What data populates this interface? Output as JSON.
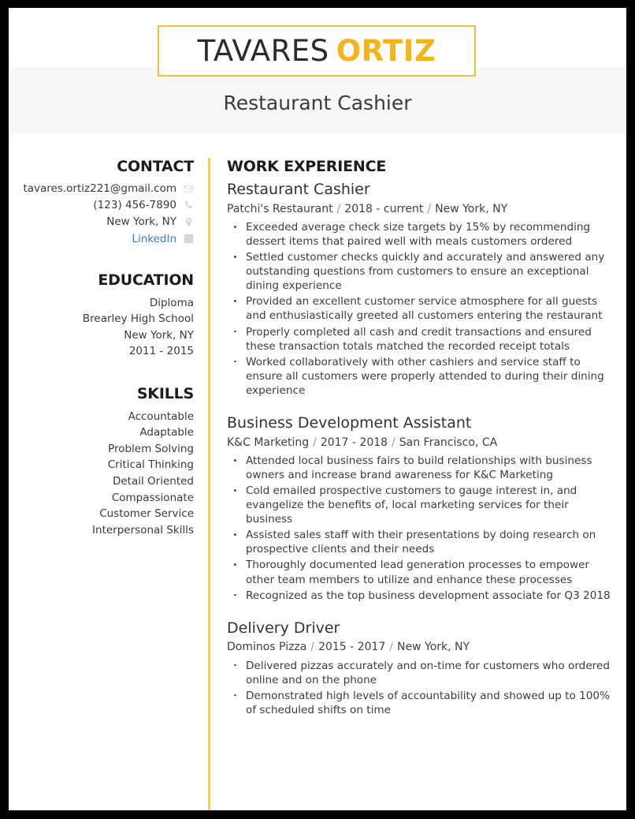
{
  "header": {
    "name_first": "TAVARES",
    "name_last": "ORTIZ",
    "job_title": "Restaurant Cashier"
  },
  "sidebar": {
    "contact": {
      "heading": "CONTACT",
      "items": [
        {
          "text": "tavares.ortiz221@gmail.com",
          "icon": "envelope-icon",
          "is_link": false
        },
        {
          "text": "(123) 456-7890",
          "icon": "phone-icon",
          "is_link": false
        },
        {
          "text": "New York, NY",
          "icon": "map-pin-icon",
          "is_link": false
        },
        {
          "text": "LinkedIn",
          "icon": "linkedin-icon",
          "is_link": true
        }
      ]
    },
    "education": {
      "heading": "EDUCATION",
      "lines": [
        "Diploma",
        "Brearley High School",
        "New York, NY",
        "2011 - 2015"
      ]
    },
    "skills": {
      "heading": "SKILLS",
      "items": [
        "Accountable",
        "Adaptable",
        "Problem Solving",
        "Critical Thinking",
        "Detail Oriented",
        "Compassionate",
        "Customer Service",
        "Interpersonal Skills"
      ]
    }
  },
  "main": {
    "heading": "WORK EXPERIENCE",
    "jobs": [
      {
        "title": "Restaurant Cashier",
        "company": "Patchi's Restaurant",
        "dates": "2018 - current",
        "location": "New York, NY",
        "bullets": [
          "Exceeded average check size targets by 15% by recommending dessert items that paired well with meals customers ordered",
          "Settled customer checks quickly and accurately and answered any outstanding questions from customers to ensure an exceptional dining experience",
          "Provided an excellent customer service atmosphere for all guests and enthusiastically greeted all customers entering the restaurant",
          "Properly completed all cash and credit transactions and ensured these transaction totals matched the recorded receipt totals",
          "Worked collaboratively with other cashiers and service staff to ensure all customers were properly attended to during their dining experience"
        ]
      },
      {
        "title": "Business Development Assistant",
        "company": "K&C Marketing",
        "dates": "2017 - 2018",
        "location": "San Francisco, CA",
        "bullets": [
          "Attended local business fairs to build relationships with business owners and increase brand awareness for K&C Marketing",
          "Cold emailed prospective customers to gauge interest in, and evangelize the benefits of, local marketing services for their business",
          "Assisted sales staff with their presentations by doing research on prospective clients and their needs",
          "Thoroughly documented lead generation processes to empower other team members to utilize and enhance these processes",
          "Recognized as the top business development associate for Q3 2018"
        ]
      },
      {
        "title": "Delivery Driver",
        "company": "Dominos Pizza",
        "dates": "2015 - 2017",
        "location": "New York, NY",
        "bullets": [
          "Delivered pizzas accurately and on-time for customers who ordered online and on the phone",
          "Demonstrated high levels of accountability and showed up to 100% of scheduled shifts on time"
        ]
      }
    ],
    "separator": "/"
  },
  "colors": {
    "accent_yellow": "#f5b41d",
    "divider_yellow": "#f2cf52",
    "box_border": "#f0c23c",
    "link_blue": "#3a7bd5",
    "band_gray": "#f7f7f6",
    "page_border": "#000000"
  }
}
